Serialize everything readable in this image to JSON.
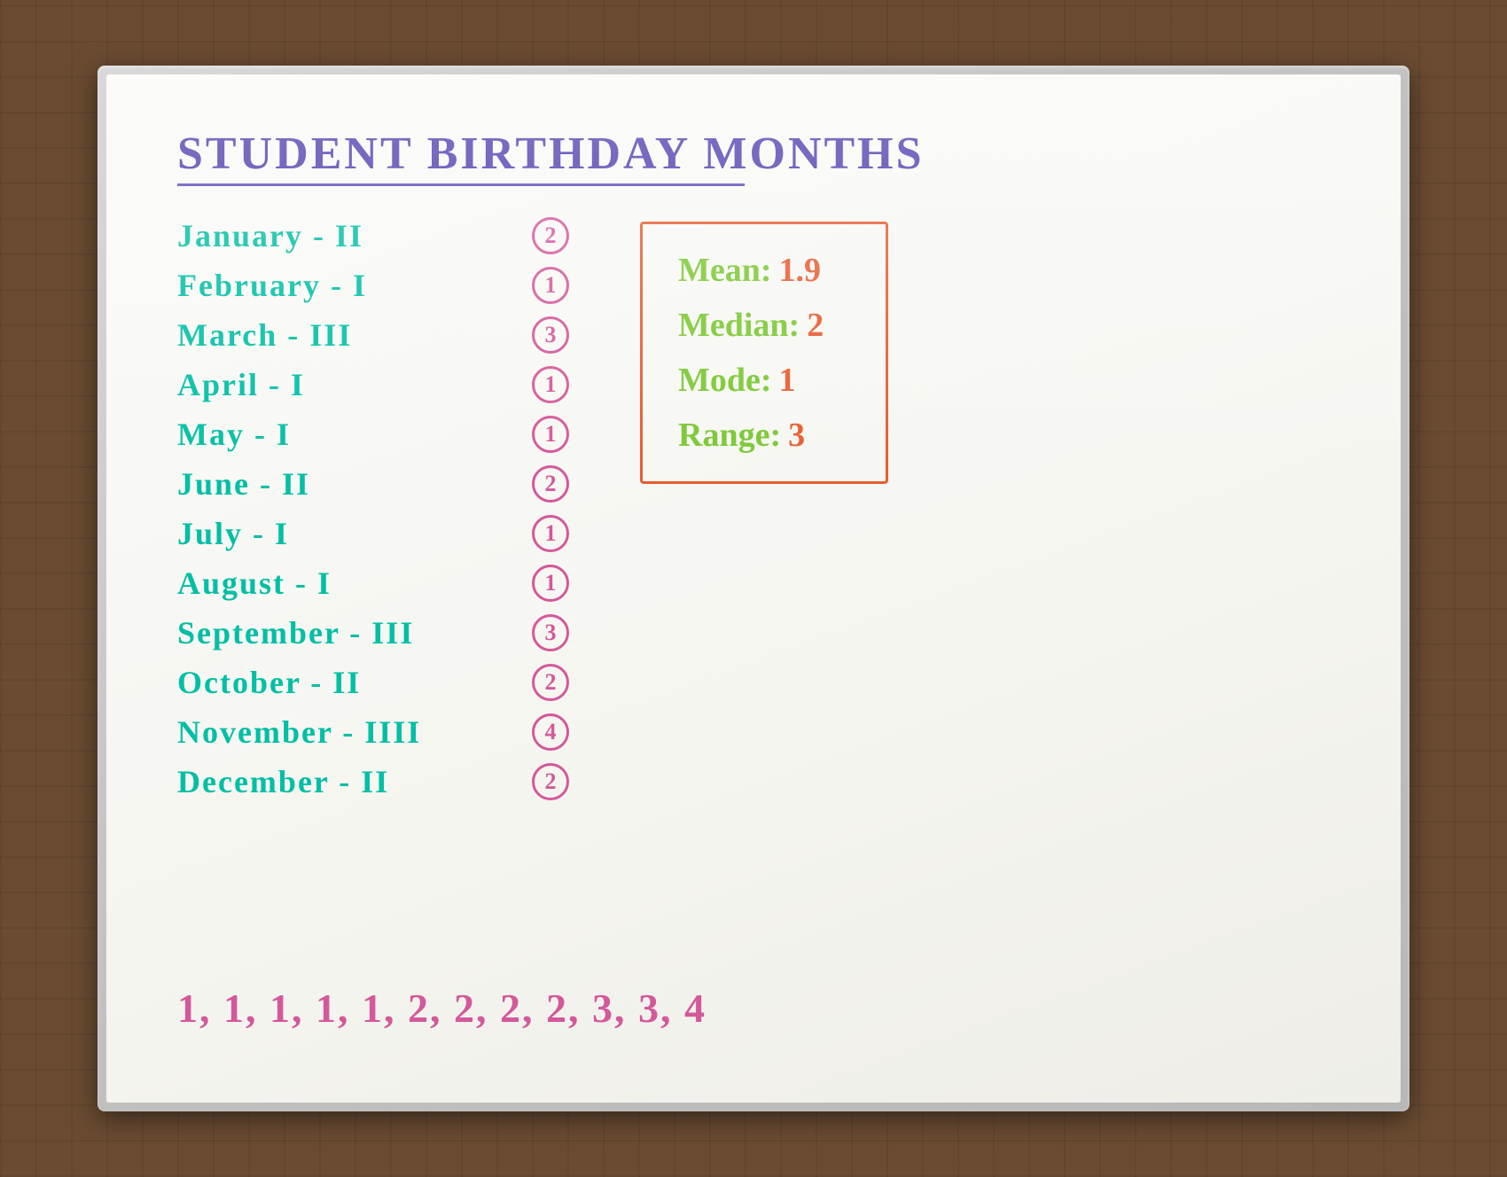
{
  "whiteboard": {
    "title": "Student Birthday Months",
    "months": [
      {
        "name": "January - II",
        "count": "2"
      },
      {
        "name": "February - I",
        "count": "1"
      },
      {
        "name": "March - III",
        "count": "3"
      },
      {
        "name": "April - I",
        "count": "1"
      },
      {
        "name": "May - I",
        "count": "1"
      },
      {
        "name": "June - II",
        "count": "2"
      },
      {
        "name": "July - I",
        "count": "1"
      },
      {
        "name": "August - I",
        "count": "1"
      },
      {
        "name": "September - III",
        "count": "3"
      },
      {
        "name": "October - II",
        "count": "2"
      },
      {
        "name": "November - IIII",
        "count": "4"
      },
      {
        "name": "December - II",
        "count": "2"
      }
    ],
    "stats": {
      "mean_label": "Mean:",
      "mean_value": "1.9",
      "median_label": "Median:",
      "median_value": "2",
      "mode_label": "Mode:",
      "mode_value": "1",
      "range_label": "Range:",
      "range_value": "3"
    },
    "sorted_data": "1, 1, 1, 1, 1, 2, 2, 2, 2, 3, 3, 4"
  }
}
